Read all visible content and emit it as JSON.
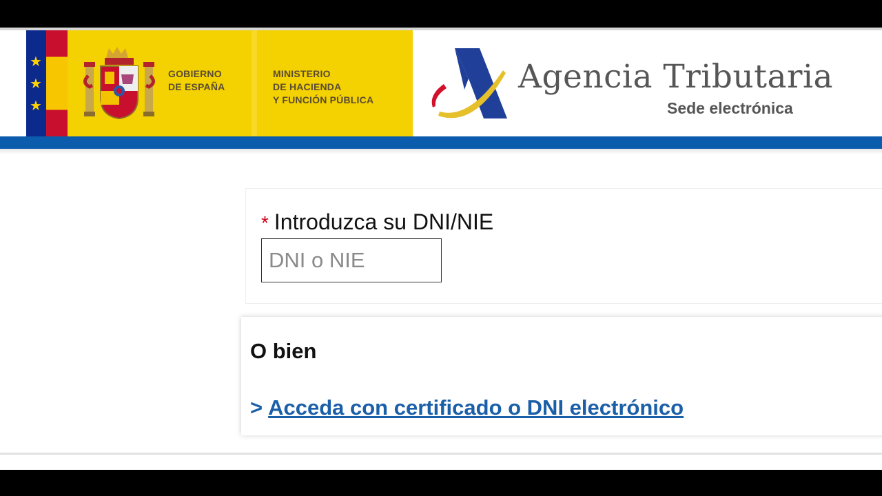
{
  "header": {
    "gov_line1": "GOBIERNO",
    "gov_line2": "DE ESPAÑA",
    "ministry_line1": "MINISTERIO",
    "ministry_line2": "DE HACIENDA",
    "ministry_line3": "Y FUNCIÓN PÚBLICA",
    "brand_title": "Agencia Tributaria",
    "brand_subtitle": "Sede electrónica"
  },
  "form": {
    "required_mark": "*",
    "dni_label": "Introduzca su DNI/NIE",
    "dni_placeholder": "DNI o NIE",
    "dni_value": ""
  },
  "alternative": {
    "title": "O bien",
    "link_prefix": ">",
    "link_text": "Acceda con certificado o DNI electrónico"
  },
  "colors": {
    "gov_yellow": "#f4d100",
    "blue_bar": "#0b5cad",
    "link_blue": "#1a5fa8",
    "required_red": "#d0021b"
  },
  "icons": [
    "spain-coat-of-arms-icon",
    "aeat-logo-icon",
    "eu-star-icon"
  ]
}
